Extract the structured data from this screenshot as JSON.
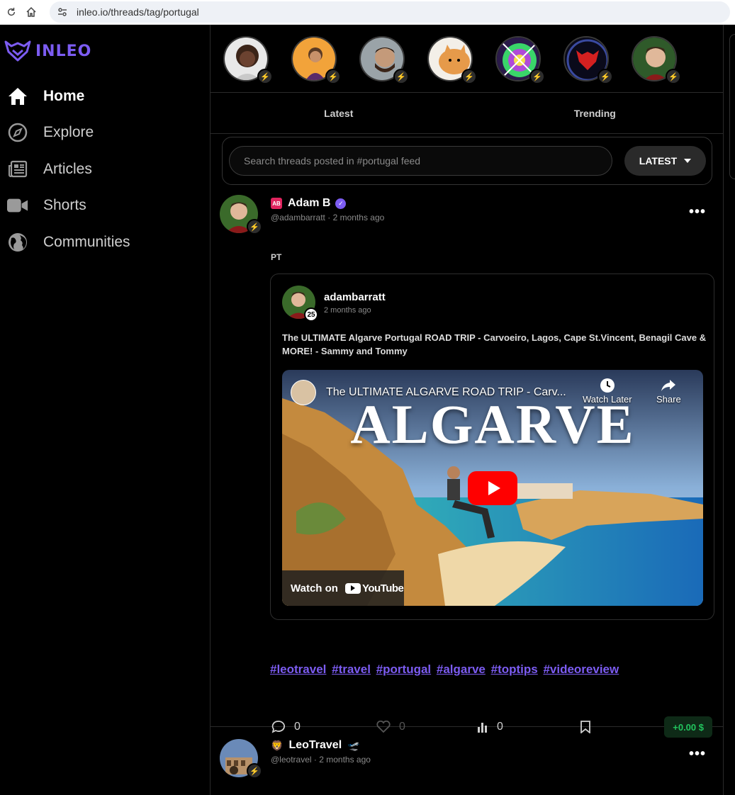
{
  "browser": {
    "url": "inleo.io/threads/tag/portugal"
  },
  "brand": {
    "logo_text": "INLEO",
    "accent": "#7c5cf2"
  },
  "sidebar": {
    "items": [
      {
        "label": "Home",
        "icon": "home-icon",
        "active": true
      },
      {
        "label": "Explore",
        "icon": "compass-icon"
      },
      {
        "label": "Articles",
        "icon": "newspaper-icon"
      },
      {
        "label": "Shorts",
        "icon": "video-camera-icon"
      },
      {
        "label": "Communities",
        "icon": "globe-icon"
      }
    ]
  },
  "stories": {
    "count": 7
  },
  "tabs": [
    {
      "label": "Latest"
    },
    {
      "label": "Trending"
    }
  ],
  "search": {
    "placeholder": "Search threads posted in #portugal feed",
    "sort_label": "LATEST"
  },
  "posts": [
    {
      "badge": "AB",
      "author": "Adam B",
      "handle": "@adambarratt",
      "time": "2 months ago",
      "meta_sep": "·",
      "text": "PT",
      "embed": {
        "author": "adambarratt",
        "time": "2 months ago",
        "reputation": "25",
        "title": "The ULTIMATE Algarve Portugal ROAD TRIP - Carvoeiro, Lagos, Cape St.Vincent, Benagil Cave & MORE! - Sammy and Tommy",
        "video": {
          "title": "The ULTIMATE ALGARVE ROAD TRIP - Carv...",
          "overlay_word": "ALGARVE",
          "watch_later": "Watch Later",
          "share": "Share",
          "watch_on": "Watch on",
          "yt_word": "YouTube"
        }
      },
      "tags": [
        "#leotravel",
        "#travel",
        "#portugal",
        "#algarve",
        "#toptips",
        "#videoreview"
      ],
      "stats": {
        "comments": "0",
        "likes": "0",
        "views": "0",
        "payout": "+0.00 $"
      },
      "payout_color": "#22c55e"
    },
    {
      "author": "LeoTravel",
      "handle": "@leotravel",
      "time": "2 months ago",
      "meta_sep": "·"
    }
  ]
}
